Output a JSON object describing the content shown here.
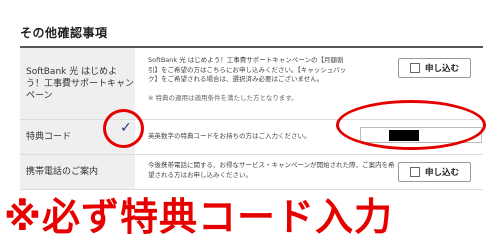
{
  "section": {
    "title": "その他確認事項"
  },
  "rows": [
    {
      "label": "SoftBank 光 はじめよう！工事費サポートキャンペーン",
      "desc1": "SoftBank 光 はじめよう！工事費サポートキャンペーンの【月額割引】をご希望の方はこちらにお申し込みください。【キャッシュバック】をご希望される場合は、選択済み必要はございません。",
      "desc2": "※ 特典の適用は適用条件を満たした方となります。",
      "button": "申し込む"
    },
    {
      "label": "特典コード",
      "desc": "英英数字の特典コードをお持ちの方はご入力ください。",
      "checkmark": "✓"
    },
    {
      "label": "携帯電話のご案内",
      "desc": "今後携帯電話に関する、お得なサービス・キャンペーンが開始された際、ご案内を希望される方はお申し込みください。",
      "button": "申し込む"
    }
  ],
  "annotation": {
    "text": "※必ず特典コード入力"
  },
  "colors": {
    "accent_red": "#e50000",
    "label_bg": "#efefef"
  }
}
